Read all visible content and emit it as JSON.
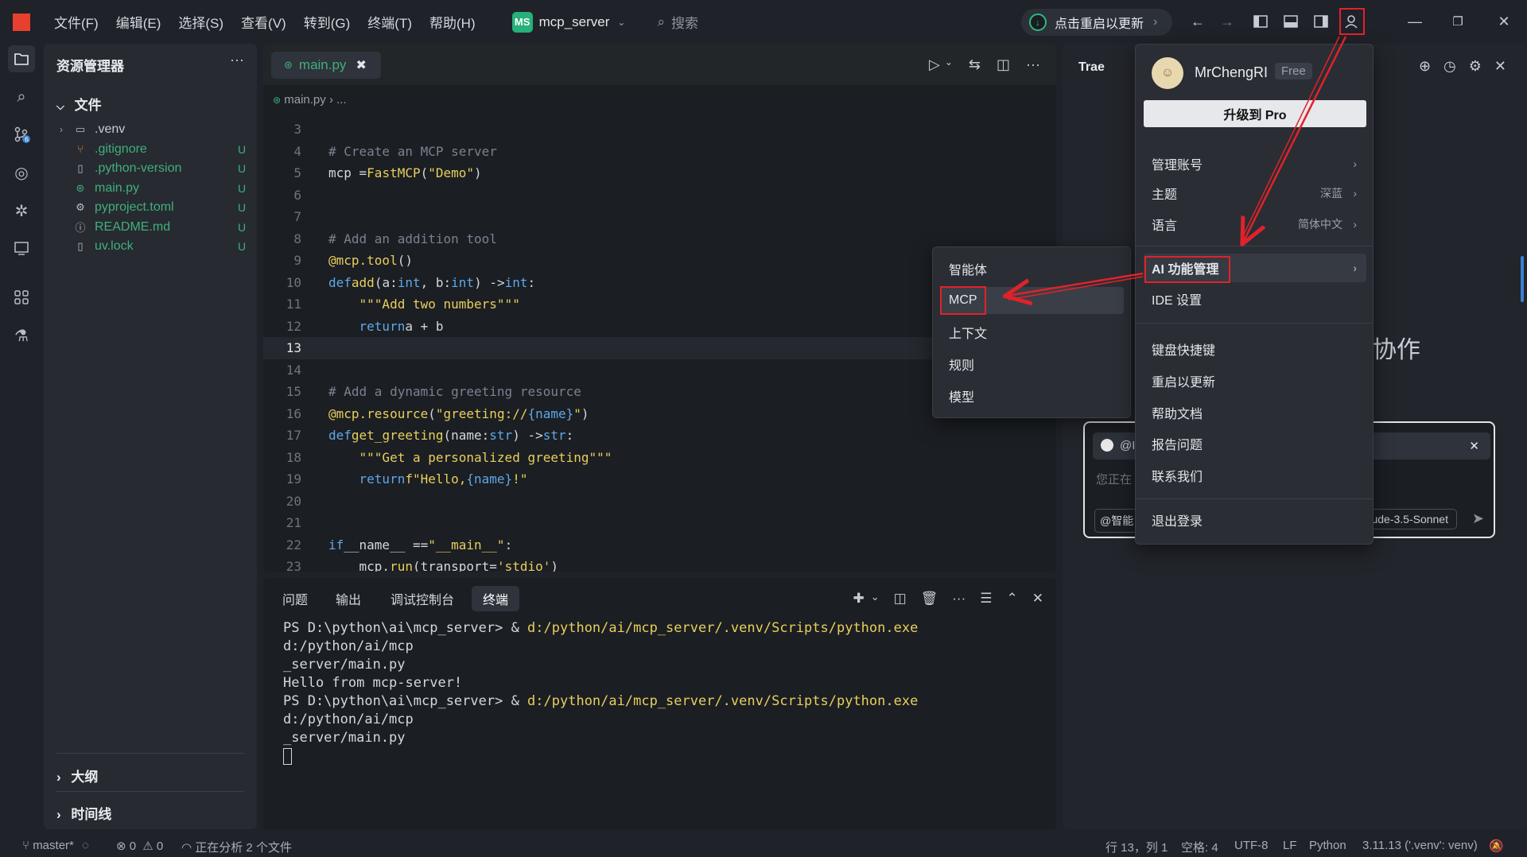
{
  "titlebar": {
    "menus": [
      "文件(F)",
      "编辑(E)",
      "选择(S)",
      "查看(V)",
      "转到(G)",
      "终端(T)",
      "帮助(H)"
    ],
    "project_badge": "MS",
    "project_name": "mcp_server",
    "search_placeholder": "搜索",
    "update_label": "点击重启以更新"
  },
  "explorer": {
    "title": "资源管理器",
    "more": "···",
    "folder": "文件",
    "files": [
      {
        "name": ".venv",
        "badge": "",
        "color": "#c8ccd4",
        "icon": "folder-icon"
      },
      {
        "name": ".gitignore",
        "badge": "U",
        "color": "#3fb07a",
        "icon": "git-icon"
      },
      {
        "name": ".python-version",
        "badge": "U",
        "color": "#3fb07a",
        "icon": "file-icon"
      },
      {
        "name": "main.py",
        "badge": "U",
        "color": "#3fb07a",
        "icon": "python-icon"
      },
      {
        "name": "pyproject.toml",
        "badge": "U",
        "color": "#3fb07a",
        "icon": "gear-icon"
      },
      {
        "name": "README.md",
        "badge": "U",
        "color": "#3fb07a",
        "icon": "info-icon"
      },
      {
        "name": "uv.lock",
        "badge": "U",
        "color": "#3fb07a",
        "icon": "file-icon"
      }
    ],
    "outline": "大纲",
    "timeline": "时间线"
  },
  "editor": {
    "tab": "main.py",
    "breadcrumb_file": "main.py",
    "breadcrumb_rest": "...",
    "current_line": 13
  },
  "panel": {
    "tabs": [
      "问题",
      "输出",
      "调试控制台",
      "终端"
    ],
    "active_tab": "终端",
    "terminal": {
      "line1_prompt": "PS D:\\python\\ai\\mcp_server> & ",
      "line1_exe": "d:/python/ai/mcp_server/.venv/Scripts/python.exe",
      "line1_arg": " d:/python/ai/mcp",
      "line2": "_server/main.py",
      "line3": "Hello from mcp-server!",
      "line4_prompt": "PS D:\\python\\ai\\mcp_server> & ",
      "line4_exe": "d:/python/ai/mcp_server/.venv/Scripts/python.exe",
      "line4_arg": " d:/python/ai/mcp",
      "line5": "_server/main.py"
    }
  },
  "chat": {
    "title": "Trae",
    "hero": "协作",
    "chip": "@I",
    "placeholder": "您正在",
    "at_label": "@智能",
    "model": "ude-3.5-Sonnet"
  },
  "account_menu": {
    "avatar": "☺",
    "username": "MrChengRI",
    "plan": "Free",
    "upgrade": "升级到 Pro",
    "items": [
      {
        "label": "管理账号",
        "value": ""
      },
      {
        "label": "主题",
        "value": "深蓝"
      },
      {
        "label": "语言",
        "value": "简体中文"
      },
      {
        "label": "AI 功能管理",
        "value": ""
      },
      {
        "label": "IDE 设置",
        "value": ""
      },
      {
        "label": "键盘快捷键",
        "value": ""
      },
      {
        "label": "重启以更新",
        "value": ""
      },
      {
        "label": "帮助文档",
        "value": ""
      },
      {
        "label": "报告问题",
        "value": ""
      },
      {
        "label": "联系我们",
        "value": ""
      },
      {
        "label": "退出登录",
        "value": ""
      }
    ]
  },
  "submenu": {
    "items": [
      "智能体",
      "MCP",
      "上下文",
      "规则",
      "模型"
    ]
  },
  "statusbar": {
    "branch": "master*",
    "errors": "0",
    "warnings": "0",
    "analyzing": "正在分析 2 个文件",
    "position": "行 13，列 1",
    "spaces": "空格: 4",
    "encoding": "UTF-8",
    "eol": "LF",
    "language": "Python",
    "interpreter": "3.11.13 ('.venv': venv)"
  }
}
